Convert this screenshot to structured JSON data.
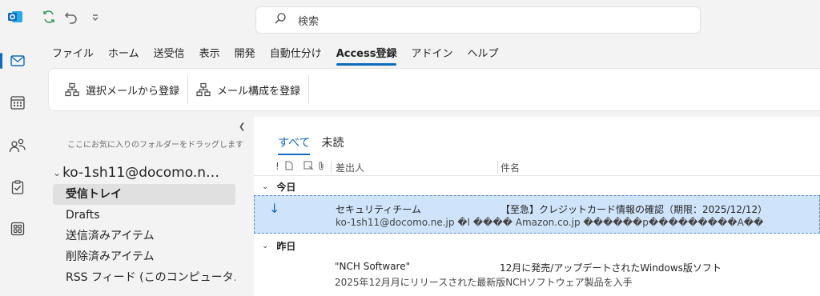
{
  "titlebar": {
    "search_placeholder": "検索",
    "icons": [
      "outlook-logo-icon",
      "sync-icon",
      "undo-icon",
      "quick-access-dropdown-icon",
      "search-icon"
    ]
  },
  "rail": {
    "items": [
      "mail-icon",
      "calendar-icon",
      "people-icon",
      "tasks-icon",
      "apps-icon"
    ],
    "active": "mail-icon"
  },
  "ribbon_tabs": [
    "ファイル",
    "ホーム",
    "送受信",
    "表示",
    "開発",
    "自動仕分け",
    "Access登録",
    "アドイン",
    "ヘルプ"
  ],
  "active_tab": "Access登録",
  "ribbon_commands": {
    "register_selected": "選択メールから登録",
    "register_structure": "メール構成を登録"
  },
  "folderpane": {
    "drop_hint": "ここにお気に入りのフォルダーをドラッグします",
    "account": "ko-1sh11@docomo.n…",
    "folders": [
      "受信トレイ",
      "Drafts",
      "送信済みアイテム",
      "削除済みアイテム",
      "RSS フィード (このコンピュータ…"
    ],
    "selected_folder": "受信トレイ"
  },
  "msglist": {
    "filters": [
      "すべて",
      "未読"
    ],
    "active_filter": "すべて",
    "columns": {
      "importance": "!",
      "sender": "差出人",
      "subject": "件名"
    },
    "groups": [
      {
        "label": "今日",
        "messages": [
          {
            "sender": "セキュリティチーム",
            "subject": "【至急】クレジットカード情報の確認（期限：2025/12/12）",
            "preview": "ko-1sh11@docomo.ne.jp �l  ���� Amazon.co.jp ������p���������A��",
            "selected": true
          }
        ]
      },
      {
        "label": "昨日",
        "messages": [
          {
            "sender": "\"NCH Software\"",
            "subject": "12月に発売/アップデートされたWindows版ソフト",
            "preview": "2025年12月月にリリースされた最新版NCHソフトウェア製品を入手",
            "selected": false
          }
        ]
      }
    ]
  },
  "colors": {
    "accent": "#0f6cbd",
    "selected_row": "#cfe4fa"
  }
}
